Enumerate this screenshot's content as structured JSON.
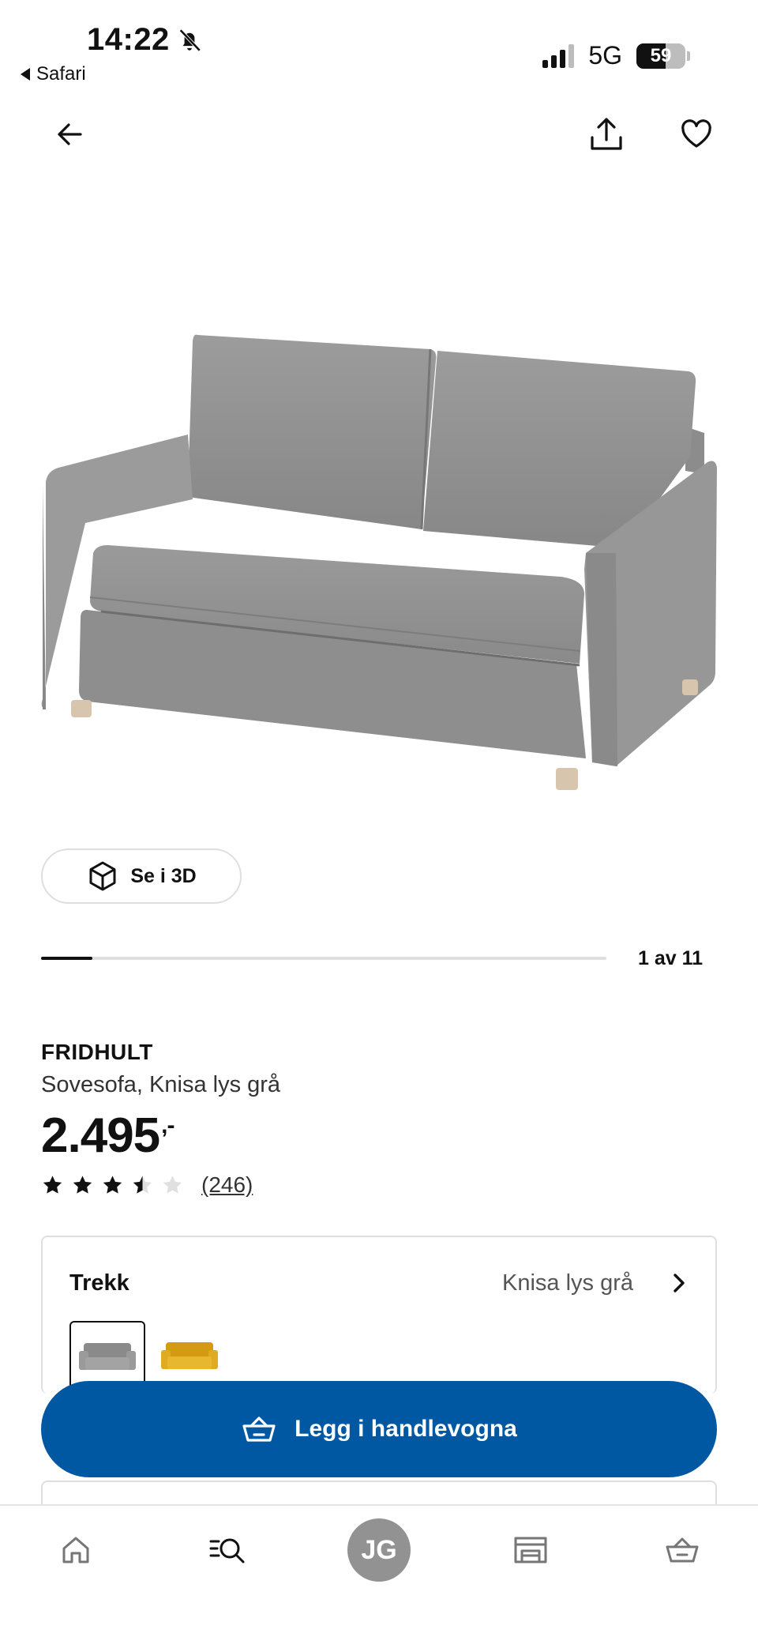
{
  "status_bar": {
    "time": "14:22",
    "back_app": "Safari",
    "network": "5G",
    "battery": "59",
    "battery_level": 0.59
  },
  "nav": {
    "back_icon": "arrow-left-icon",
    "share_icon": "share-icon",
    "favorite_icon": "heart-icon"
  },
  "media": {
    "image_alt": "FRIDHULT sovesofa grå",
    "view_3d_label": "Se i 3D",
    "counter": "1 av 11",
    "current_index": 1,
    "total": 11
  },
  "product": {
    "brand": "FRIDHULT",
    "description": "Sovesofa, Knisa lys grå",
    "price": "2.495",
    "price_suffix": ",-",
    "rating": 3.5,
    "rating_max": 5,
    "review_count": "(246)"
  },
  "cover": {
    "title": "Trekk",
    "selected_value": "Knisa lys grå",
    "swatches": [
      {
        "color": "#8a8a8a",
        "selected": true
      },
      {
        "color": "#e0aa22",
        "selected": false
      }
    ]
  },
  "cart": {
    "add_label": "Legg i handlevogna",
    "accent": "#0058a3"
  },
  "bottom_nav": {
    "home_icon": "home-icon",
    "search_icon": "search-list-icon",
    "avatar_initials": "JG",
    "store_icon": "store-icon",
    "cart_icon": "basket-icon"
  }
}
